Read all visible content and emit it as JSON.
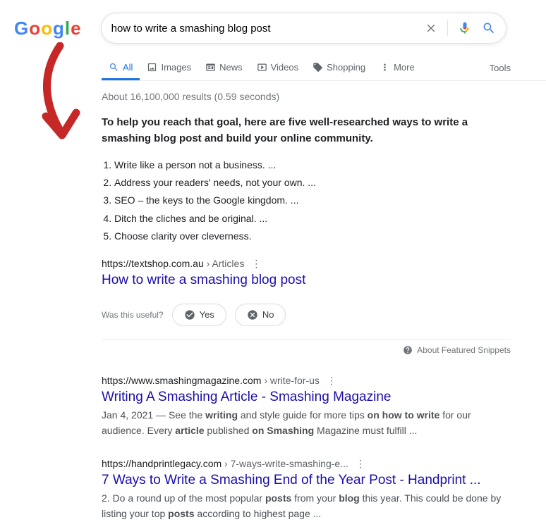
{
  "search": {
    "query": "how to write a smashing blog post"
  },
  "tabs": {
    "all": "All",
    "images": "Images",
    "news": "News",
    "videos": "Videos",
    "shopping": "Shopping",
    "more": "More",
    "tools": "Tools"
  },
  "stats": "About 16,100,000 results (0.59 seconds)",
  "snippet": {
    "intro": "To help you reach that goal, here are five well-researched ways to write a smashing blog post and build your online community.",
    "items": [
      "Write like a person not a business. ...",
      "Address your readers' needs, not your own. ...",
      "SEO – the keys to the Google kingdom. ...",
      "Ditch the cliches and be original. ...",
      "Choose clarity over cleverness."
    ],
    "url_host": "https://textshop.com.au",
    "url_path": " › Articles",
    "title": "How to write a smashing blog post"
  },
  "feedback": {
    "prompt": "Was this useful?",
    "yes": "Yes",
    "no": "No",
    "about": "About Featured Snippets"
  },
  "results": [
    {
      "url_host": "https://www.smashingmagazine.com",
      "url_path": " › write-for-us",
      "title": "Writing A Smashing Article - Smashing Magazine",
      "desc_html": "Jan 4, 2021 — See the <b>writing</b> and style guide for more tips <b>on how to write</b> for our audience. Every <b>article</b> published <b>on Smashing</b> Magazine must fulfill ..."
    },
    {
      "url_host": "https://handprintlegacy.com",
      "url_path": " › 7-ways-write-smashing-e...",
      "title": "7 Ways to Write a Smashing End of the Year Post - Handprint ...",
      "desc_html": "2. Do a round up of the most popular <b>posts</b> from your <b>blog</b> this year. This could be done by listing your top <b>posts</b> according to highest page ..."
    }
  ]
}
